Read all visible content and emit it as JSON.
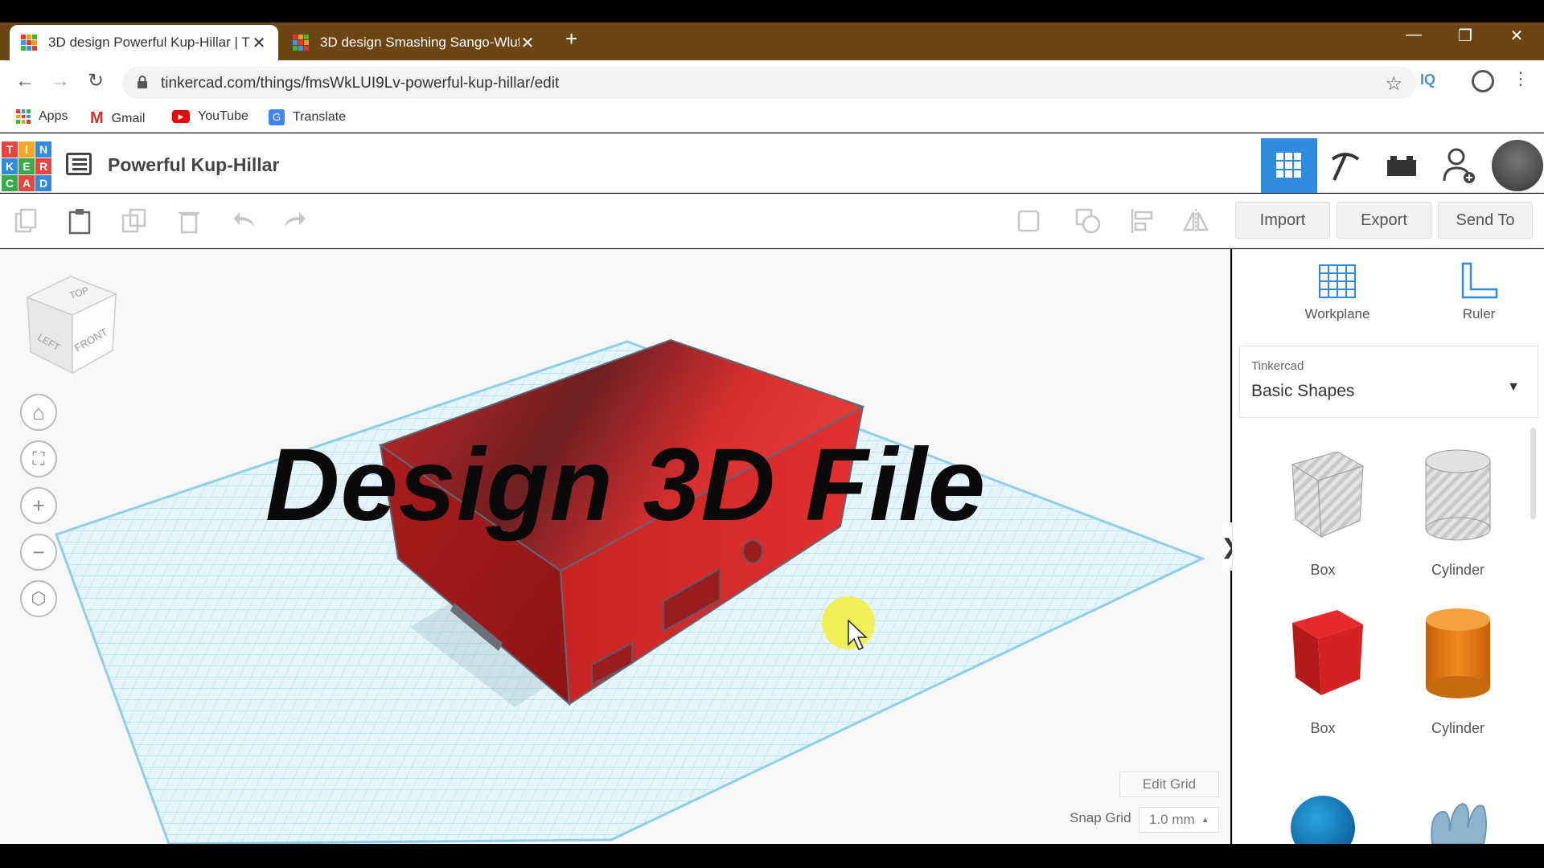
{
  "browser": {
    "tabs": [
      {
        "title": "3D design Powerful Kup-Hillar | T",
        "active": true
      },
      {
        "title": "3D design Smashing Sango-Wluf",
        "active": false
      }
    ],
    "url": "tinkercad.com/things/fmsWkLUI9Lv-powerful-kup-hillar/edit",
    "extension_label": "IQ",
    "bookmarks": [
      {
        "label": "Apps",
        "icon": "apps-grid-icon"
      },
      {
        "label": "Gmail",
        "icon": "gmail-icon"
      },
      {
        "label": "YouTube",
        "icon": "youtube-icon"
      },
      {
        "label": "Translate",
        "icon": "translate-icon"
      }
    ]
  },
  "app": {
    "logo_letters": [
      "T",
      "I",
      "N",
      "K",
      "E",
      "R",
      "C",
      "A",
      "D"
    ],
    "design_name": "Powerful Kup-Hillar",
    "overlay_title": "Design 3D File",
    "actions": {
      "import": "Import",
      "export": "Export",
      "send_to": "Send To"
    },
    "view_cube": {
      "top": "TOP",
      "left": "LEFT",
      "front": "FRONT"
    },
    "edit_grid": "Edit Grid",
    "snap_grid_label": "Snap Grid",
    "snap_grid_value": "1.0 mm",
    "panel": {
      "workplane": "Workplane",
      "ruler": "Ruler",
      "library_sub": "Tinkercad",
      "library_value": "Basic Shapes",
      "shapes": [
        {
          "label": "Box",
          "kind": "box-hole"
        },
        {
          "label": "Cylinder",
          "kind": "cylinder-hole"
        },
        {
          "label": "Box",
          "kind": "box-solid"
        },
        {
          "label": "Cylinder",
          "kind": "cylinder-solid"
        }
      ]
    }
  },
  "colors": {
    "accent": "#2f8bde",
    "chrome_frame": "#6d4513",
    "grid": "#8ecfe6",
    "model_red": "#d62d2d"
  }
}
